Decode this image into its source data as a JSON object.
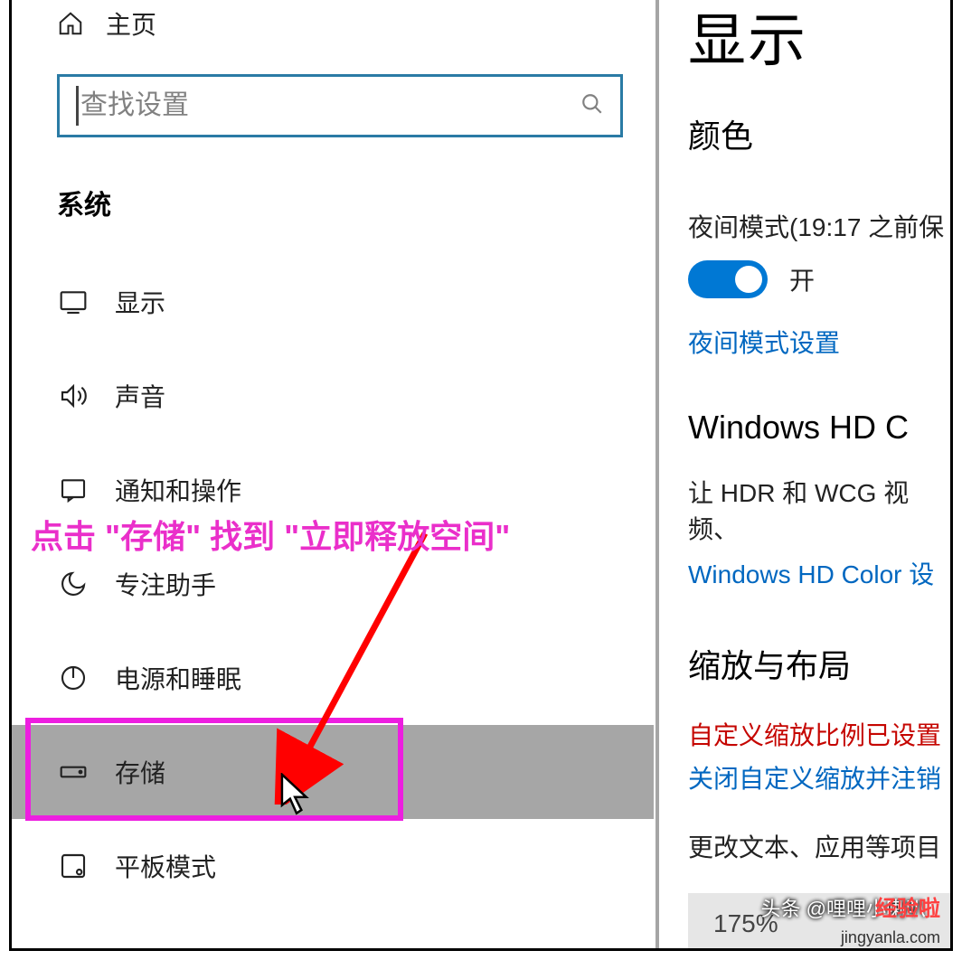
{
  "sidebar": {
    "home_label": "主页",
    "search_placeholder": "查找设置",
    "section_label": "系统",
    "items": [
      {
        "label": "显示"
      },
      {
        "label": "声音"
      },
      {
        "label": "通知和操作"
      },
      {
        "label": "专注助手"
      },
      {
        "label": "电源和睡眠"
      },
      {
        "label": "存储"
      },
      {
        "label": "平板模式"
      }
    ]
  },
  "main": {
    "title": "显示",
    "color_heading": "颜色",
    "night_mode_label": "夜间模式(19:17 之前保",
    "toggle_state": "开",
    "night_settings_link": "夜间模式设置",
    "hd_heading": "Windows HD C",
    "hd_desc": "让 HDR 和 WCG 视频、",
    "hd_link": "Windows HD Color 设",
    "scale_heading": "缩放与布局",
    "scale_warn": "自定义缩放比例已设置",
    "scale_link": "关闭自定义缩放并注销",
    "scale_desc": "更改文本、应用等项目",
    "scale_value": "175%"
  },
  "annotation": {
    "text": "点击 \"存储\" 找到 \"立即释放空间\""
  },
  "watermark": {
    "line1": "头条 @哩哩小喇叭",
    "line2": "经验啦",
    "line3": "jingyanla.com"
  }
}
